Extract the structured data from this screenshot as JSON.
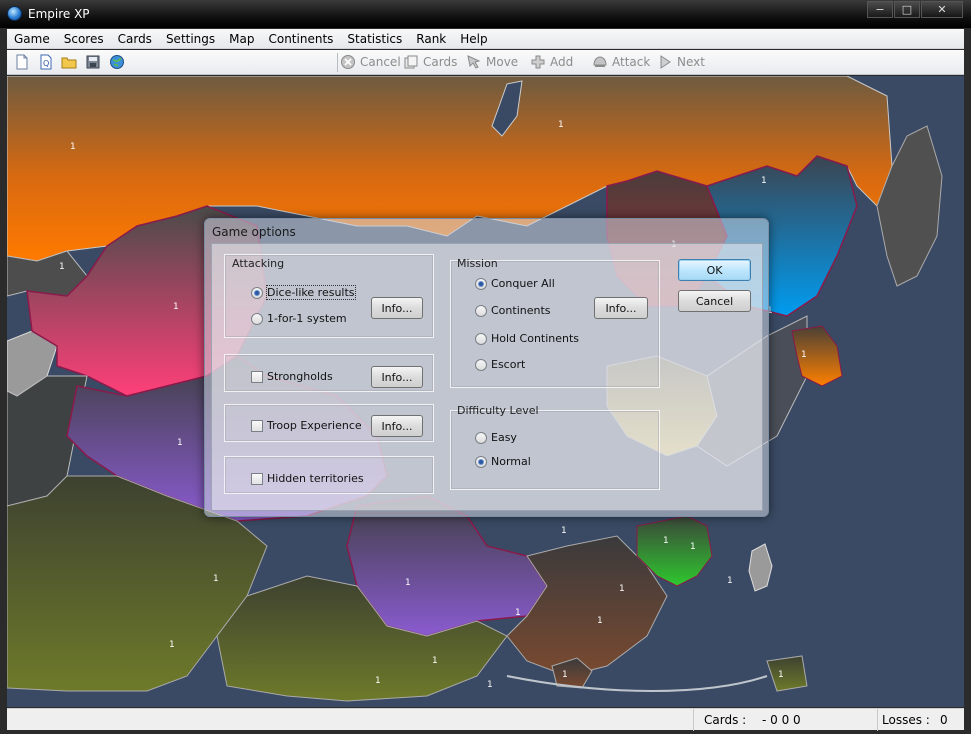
{
  "window": {
    "title": "Empire XP",
    "min": "−",
    "max": "□",
    "close": "✕"
  },
  "menu": [
    "Game",
    "Scores",
    "Cards",
    "Settings",
    "Map",
    "Continents",
    "Statistics",
    "Rank",
    "Help"
  ],
  "toolbar": {
    "icons": [
      "new-game-icon",
      "open-scenario-icon",
      "open-folder-icon",
      "save-icon",
      "globe-icon"
    ],
    "cancel": "Cancel",
    "cards": "Cards",
    "move": "Move",
    "add": "Add",
    "attack": "Attack",
    "next": "Next"
  },
  "map": {
    "army_label": "1"
  },
  "dialog": {
    "title": "Game options",
    "attacking": {
      "label": "Attacking",
      "dice": "Dice-like results",
      "one_for_one": "1-for-1 system",
      "info": "Info..."
    },
    "strongholds": {
      "label": "Strongholds",
      "info": "Info...",
      "checked": false
    },
    "troop_experience": {
      "label": "Troop Experience",
      "info": "Info...",
      "checked": false
    },
    "hidden_territories": {
      "label": "Hidden territories",
      "checked": false
    },
    "mission": {
      "label": "Mission",
      "conquer_all": "Conquer All",
      "continents": "Continents",
      "hold_continents": "Hold Continents",
      "escort": "Escort",
      "info": "Info...",
      "selected": "Conquer All"
    },
    "difficulty": {
      "label": "Difficulty Level",
      "easy": "Easy",
      "normal": "Normal",
      "selected": "Normal"
    },
    "ok": "OK",
    "cancel": "Cancel"
  },
  "status": {
    "cards_label": "Cards :",
    "cards_value": "- 0 0 0",
    "losses_label": "Losses :",
    "losses_value": "0"
  },
  "colors": {
    "sea": "#3a4a64",
    "accent": "#3c7fb1"
  }
}
